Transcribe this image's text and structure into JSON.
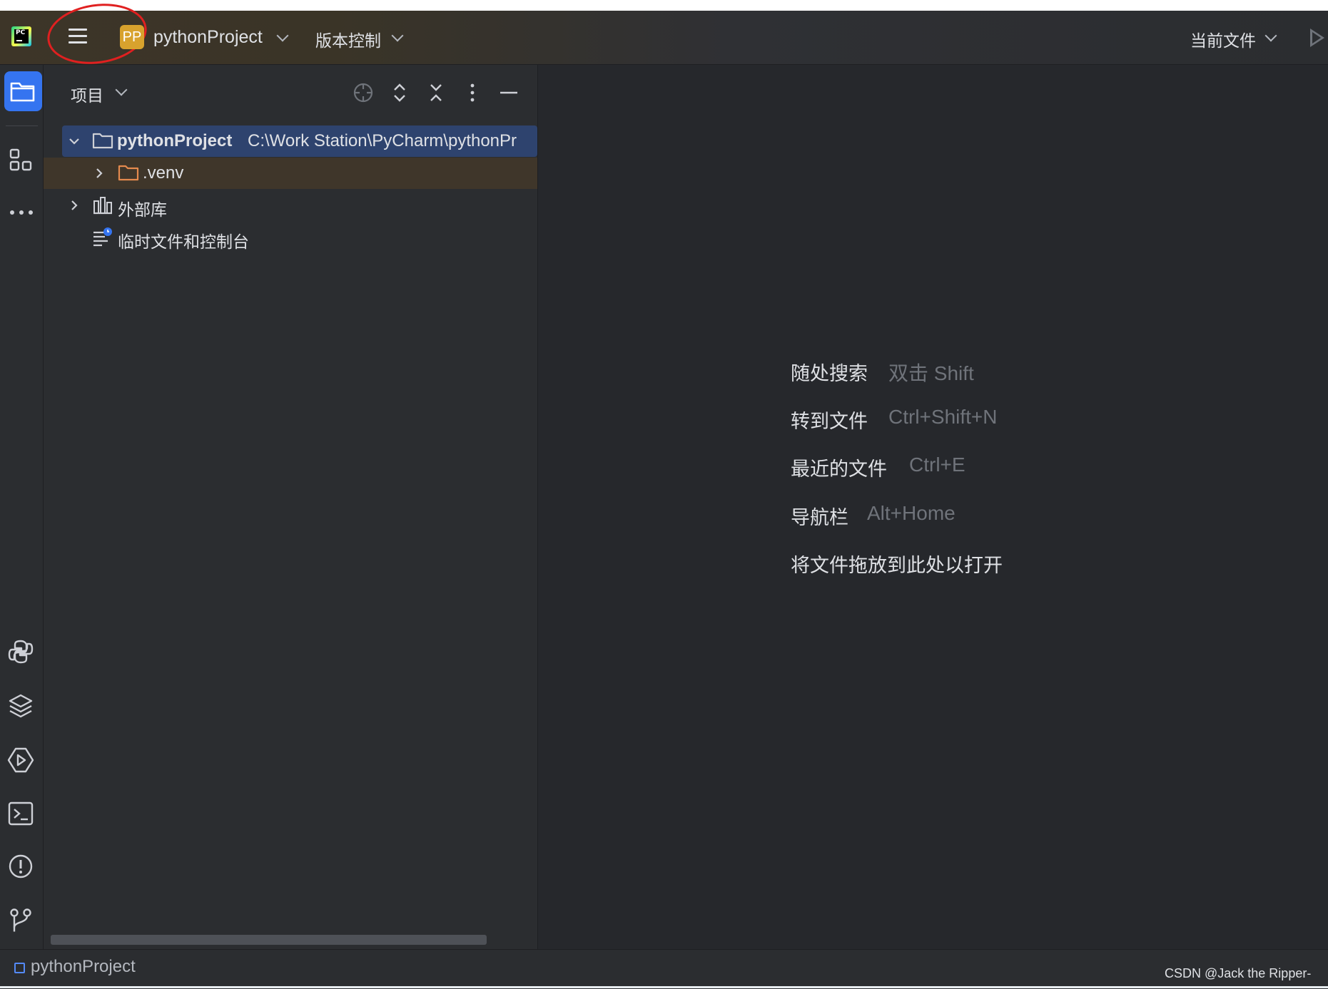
{
  "titlebar": {
    "project_badge": "PP",
    "project_name": "pythonProject",
    "vcs_label": "版本控制",
    "run_config": "当前文件"
  },
  "project_panel": {
    "title": "项目",
    "tree": {
      "root_name": "pythonProject",
      "root_path": "C:\\Work Station\\PyCharm\\pythonPr",
      "venv": ".venv",
      "external_libs": "外部库",
      "scratches": "临时文件和控制台"
    }
  },
  "editor_hints": [
    {
      "label": "随处搜索",
      "key": "双击 Shift"
    },
    {
      "label": "转到文件",
      "key": "Ctrl+Shift+N"
    },
    {
      "label": "最近的文件",
      "key": "Ctrl+E"
    },
    {
      "label": "导航栏",
      "key": "Alt+Home"
    },
    {
      "label": "将文件拖放到此处以打开",
      "key": ""
    }
  ],
  "statusbar": {
    "breadcrumb": "pythonProject",
    "watermark": "CSDN @Jack the Ripper-"
  },
  "colors": {
    "accent": "#3574f0",
    "selection": "#2e436e",
    "highlight_row": "#3f362a",
    "annotation": "#e02020",
    "project_badge": "#d8a22d"
  }
}
